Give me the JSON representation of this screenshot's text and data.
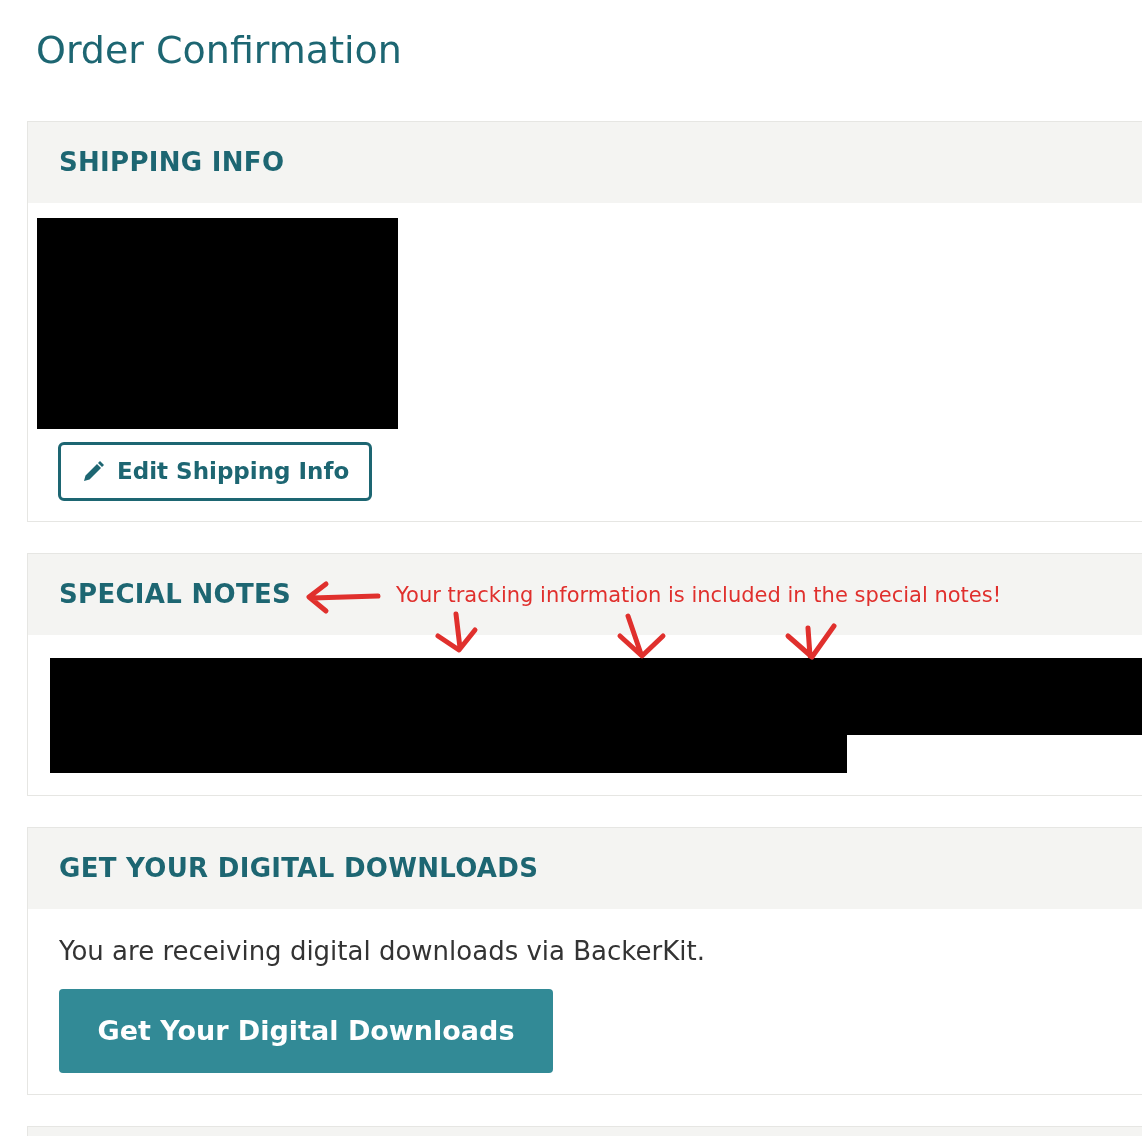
{
  "page_title": "Order Confirmation",
  "sections": [
    {
      "kind": "shipping",
      "title": "SHIPPING INFO",
      "button": "Edit Shipping Info"
    },
    {
      "kind": "notes",
      "title": "SPECIAL NOTES",
      "annotation": "Your tracking information is included in the special notes!"
    },
    {
      "kind": "downloads",
      "title": "GET YOUR DIGITAL DOWNLOADS",
      "text": "You are receiving digital downloads via BackerKit.",
      "button": "Get Your Digital Downloads"
    }
  ]
}
